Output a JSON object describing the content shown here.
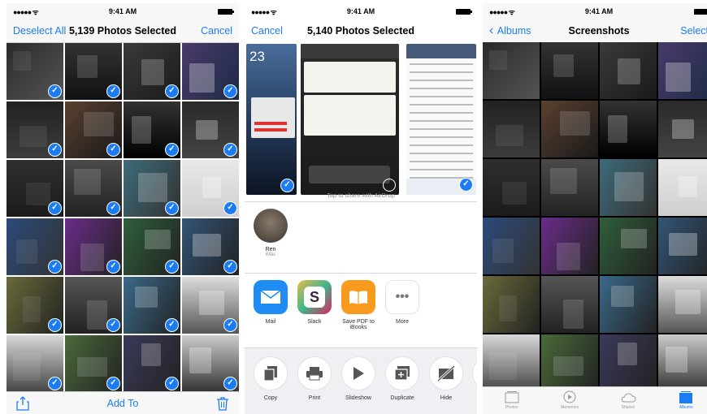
{
  "screen1": {
    "status": {
      "carrier": "●●●●● ᯤ",
      "time": "9:41 AM"
    },
    "nav": {
      "left": "Deselect All",
      "title": "5,139 Photos Selected",
      "right": "Cancel"
    },
    "toolbar": {
      "center": "Add To"
    }
  },
  "screen2": {
    "status": {
      "carrier": "●●●●● ᯤ",
      "time": "9:41 AM"
    },
    "nav": {
      "left": "Cancel",
      "title": "5,140 Photos Selected"
    },
    "airdrop_hint": "Tap to share with AirDrop",
    "contact": {
      "name": "Ren",
      "device": "iMac"
    },
    "apps": [
      {
        "label": "Mail",
        "color": "#1e8cf2"
      },
      {
        "label": "Slack",
        "color": "#e6e6e6"
      },
      {
        "label": "Save PDF to iBooks",
        "color": "#f79a1e"
      },
      {
        "label": "More",
        "color": "#f2f2f2"
      }
    ],
    "actions": [
      {
        "label": "Copy"
      },
      {
        "label": "Print"
      },
      {
        "label": "Slideshow"
      },
      {
        "label": "Duplicate"
      },
      {
        "label": "Hide"
      }
    ]
  },
  "screen3": {
    "status": {
      "carrier": "●●●●● ᯤ",
      "time": "9:41 AM"
    },
    "nav": {
      "back": "Albums",
      "title": "Screenshots",
      "right": "Select"
    },
    "tabs": [
      {
        "label": "Photos",
        "active": false
      },
      {
        "label": "Memories",
        "active": false
      },
      {
        "label": "Shared",
        "active": false
      },
      {
        "label": "Albums",
        "active": true
      }
    ]
  },
  "colors": {
    "accent": "#1b7cf4"
  }
}
